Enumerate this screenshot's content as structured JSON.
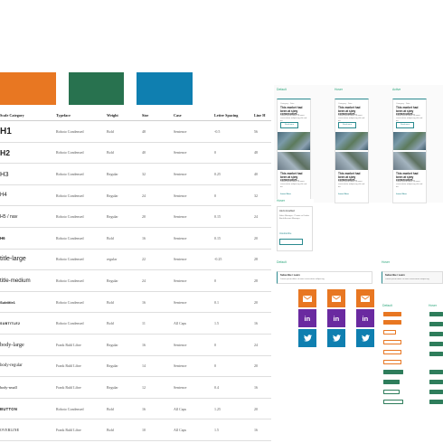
{
  "colors": {
    "orange": "#e87722",
    "green": "#28724f",
    "blue": "#0f7fb0",
    "purple": "#6a2aa0",
    "teal": "#2a8a8f"
  },
  "table": {
    "headers": [
      "Scale Category",
      "Typeface",
      "Weight",
      "Size",
      "Case",
      "Letter Spacing",
      "Line H"
    ],
    "rows": [
      {
        "cat": "H1",
        "typeface": "Roboto Condensed",
        "weight": "Bold",
        "size": "48",
        "case": "Sentence",
        "spacing": "-0.5",
        "line": "56"
      },
      {
        "cat": "H2",
        "typeface": "Roboto Condensed",
        "weight": "Bold",
        "size": "40",
        "case": "Sentence",
        "spacing": "0",
        "line": "48"
      },
      {
        "cat": "H3",
        "typeface": "Roboto Condensed",
        "weight": "Regular",
        "size": "32",
        "case": "Sentence",
        "spacing": "0.25",
        "line": "40"
      },
      {
        "cat": "H4",
        "typeface": "Roboto Condensed",
        "weight": "Regular",
        "size": "24",
        "case": "Sentence",
        "spacing": "0",
        "line": "32"
      },
      {
        "cat": "H5 / nav",
        "typeface": "Roboto Condensed",
        "weight": "Regular",
        "size": "20",
        "case": "Sentence",
        "spacing": "0.15",
        "line": "24"
      },
      {
        "cat": "H6",
        "typeface": "Roboto Condensed",
        "weight": "Bold",
        "size": "16",
        "case": "Sentence",
        "spacing": "0.15",
        "line": "20"
      },
      {
        "cat": "title-large",
        "typeface": "Roboto Condensed",
        "weight": "regular",
        "size": "22",
        "case": "Sentence",
        "spacing": "-0.25",
        "line": "28"
      },
      {
        "cat": "title-medium",
        "typeface": "Roboto Condensed",
        "weight": "Regular",
        "size": "24",
        "case": "Sentence",
        "spacing": "0",
        "line": "28"
      },
      {
        "cat": "Subtitle1",
        "typeface": "Roboto Condensed",
        "weight": "Bold",
        "size": "16",
        "case": "Sentence",
        "spacing": "0.1",
        "line": "20"
      },
      {
        "cat": "SUBTITLE2",
        "typeface": "Roboto Condensed",
        "weight": "Bold",
        "size": "11",
        "case": "All Caps",
        "spacing": "1.5",
        "line": "16"
      },
      {
        "cat": "body-large",
        "typeface": "Frank Ruhl Libre",
        "weight": "Regular",
        "size": "16",
        "case": "Sentence",
        "spacing": "0",
        "line": "24"
      },
      {
        "cat": "body-regular",
        "typeface": "Frank Ruhl Libre",
        "weight": "Regular",
        "size": "14",
        "case": "Sentence",
        "spacing": "0",
        "line": "20"
      },
      {
        "cat": "body-small",
        "typeface": "Frank Ruhl Libre",
        "weight": "Regular",
        "size": "12",
        "case": "Sentence",
        "spacing": "0.4",
        "line": "16"
      },
      {
        "cat": "BUTTON",
        "typeface": "Roboto Condensed",
        "weight": "Bold",
        "size": "16",
        "case": "All Caps",
        "spacing": "1.25",
        "line": "20"
      },
      {
        "cat": "OVERLINE",
        "typeface": "Frank Ruhl Libre",
        "weight": "Bold",
        "size": "10",
        "case": "All Caps",
        "spacing": "1.5",
        "line": "16"
      }
    ]
  },
  "cards": {
    "labels": [
      "Default",
      "Hover",
      "Active"
    ],
    "meta": "Category · Date",
    "title": "This market had been at sixty consecutive...",
    "body": "Lorem ipsum dolor sit amet, consectetur adipiscing elit sed do.",
    "button": "Read more",
    "link": "Learn More"
  },
  "widget": {
    "label": "Hover",
    "lines": [
      "Alerts Enabled",
      "Sales Manager - Private or Dealer Bank Account Manager",
      "Unsubscribe"
    ]
  },
  "banners": {
    "labels": [
      "Default",
      "Hover"
    ],
    "title": "Subscribe / Learn",
    "body": "Lorem ipsum dolor sit amet consectetur adipiscing."
  },
  "social": {
    "icons": [
      "mail-icon",
      "linkedin-icon",
      "twitter-icon"
    ]
  },
  "buttons": {
    "labels": [
      "Default",
      "Hover"
    ]
  }
}
